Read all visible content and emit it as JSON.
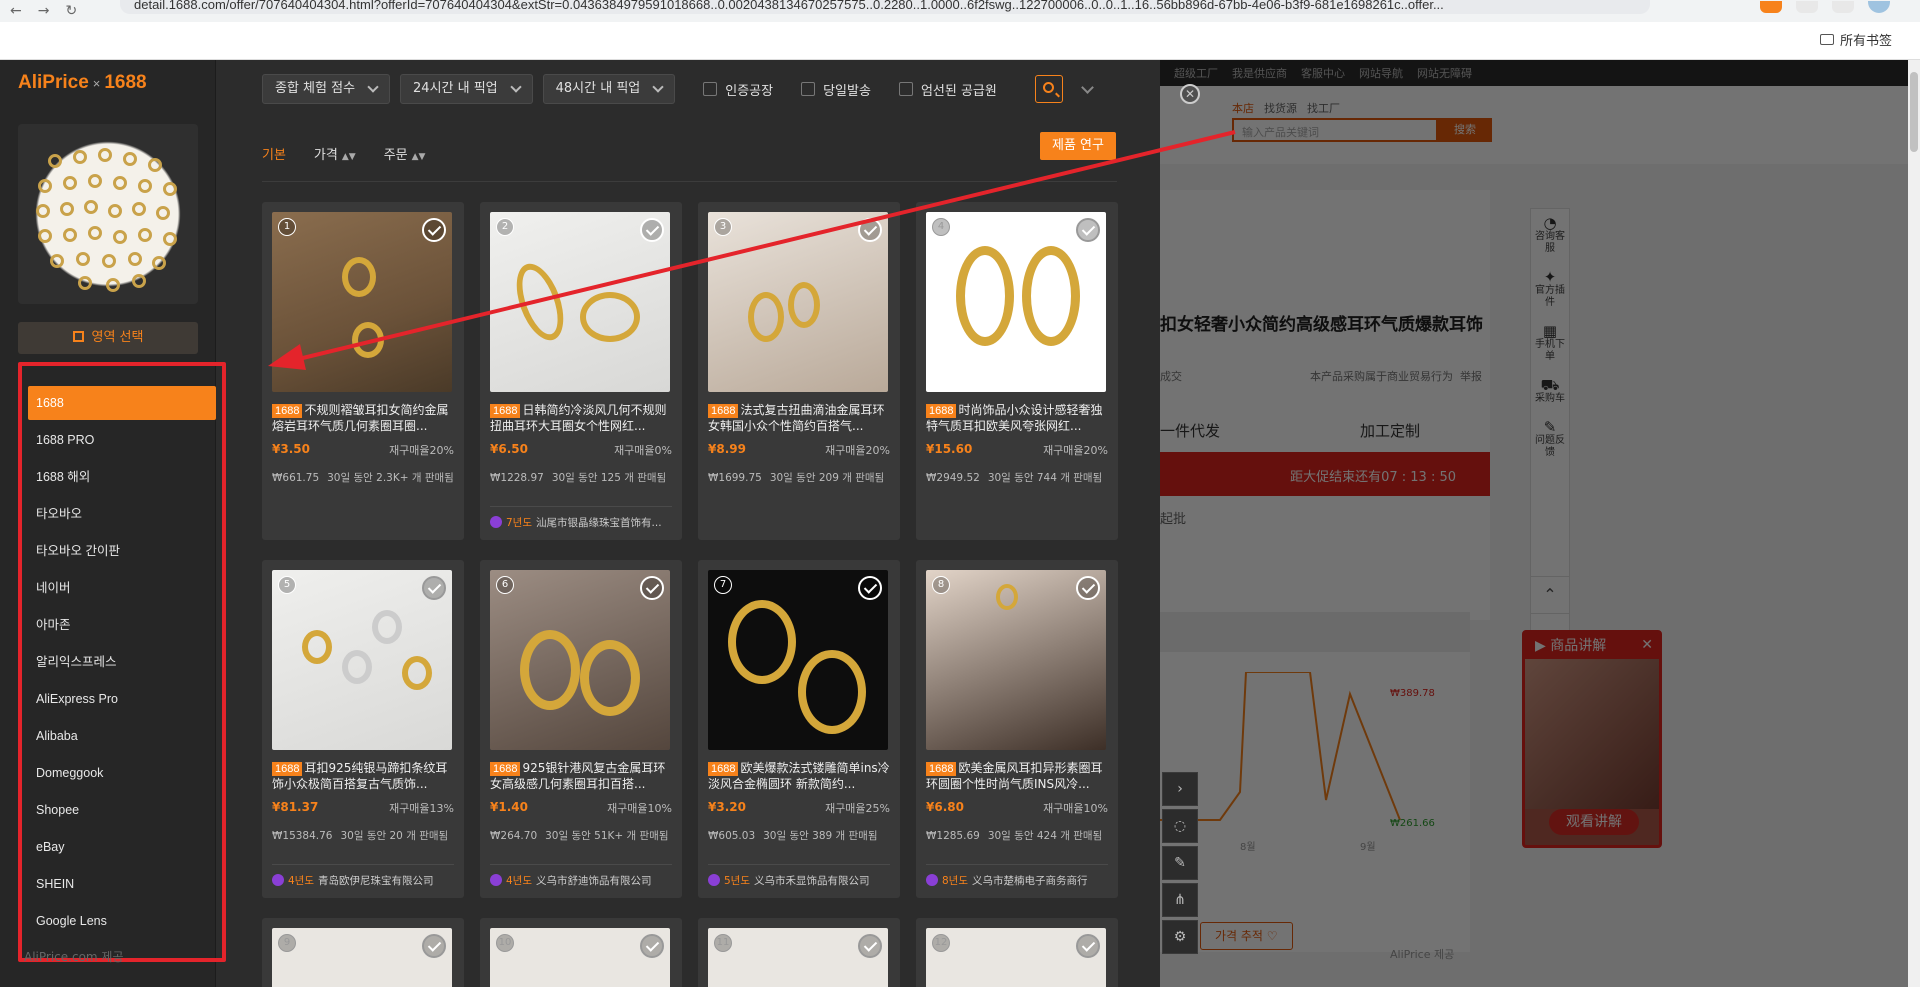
{
  "browser": {
    "url": "detail.1688.com/offer/707640404304.html?offerId=707640404304&extStr=0.0436384979591018668..0.0020438134670257575..0.2280..1.0000..6f2fswg..122700006..0..0..1..16..56bb896d-67bb-4e06-b3f9-681e1698261c..offer...",
    "bookmarks_label": "所有书签"
  },
  "panel": {
    "brand_left": "AliPrice",
    "brand_sep": "×",
    "brand_right": "1688",
    "area_select_label": "영역 선택",
    "sources": [
      {
        "label": "1688",
        "active": true
      },
      {
        "label": "1688 PRO"
      },
      {
        "label": "1688 해외"
      },
      {
        "label": "타오바오"
      },
      {
        "label": "타오바오 간이판"
      },
      {
        "label": "네이버"
      },
      {
        "label": "아마존"
      },
      {
        "label": "알리익스프레스"
      },
      {
        "label": "AliExpress Pro"
      },
      {
        "label": "Alibaba"
      },
      {
        "label": "Domeggook"
      },
      {
        "label": "Shopee"
      },
      {
        "label": "eBay"
      },
      {
        "label": "SHEIN"
      },
      {
        "label": "Google Lens"
      }
    ],
    "powered_by": "AliPrice.com 제공"
  },
  "filters": {
    "score": "종합 체험 점수",
    "pickup24": "24시간 내 픽업",
    "pickup48": "48시간 내 픽업",
    "certified": "인증공장",
    "sameday": "당일발송",
    "selected": "엄선된 공급원"
  },
  "sort": {
    "basic": "기본",
    "price": "가격",
    "orders": "주문",
    "research": "제품 연구"
  },
  "products": [
    {
      "n": "1",
      "badge": "1688",
      "title": "不规则褶皱耳扣女简约金属熔岩耳环气质几何素圈耳圈...",
      "price": "¥3.50",
      "rep": "재구매율20%",
      "krw": "₩661.75",
      "sold": "30일 동안 2.3K+ 개 판매됨",
      "seller": ""
    },
    {
      "n": "2",
      "badge": "1688",
      "title": "日韩简约冷淡风几何不规则扭曲耳环大耳圈女个性网红...",
      "price": "¥6.50",
      "rep": "재구매율0%",
      "krw": "₩1228.97",
      "sold": "30일 동안 125 개 판매됨",
      "years": "7년도",
      "seller": "汕尾市银晶缘珠宝首饰有..."
    },
    {
      "n": "3",
      "badge": "1688",
      "title": "法式复古扭曲滴油金属耳环女韩国小众个性简约百搭气...",
      "price": "¥8.99",
      "rep": "재구매율20%",
      "krw": "₩1699.75",
      "sold": "30일 동안 209 개 판매됨",
      "seller": ""
    },
    {
      "n": "4",
      "badge": "1688",
      "title": "时尚饰品小众设计感轻奢独特气质耳扣欧美风夸张网红...",
      "price": "¥15.60",
      "rep": "재구매율20%",
      "krw": "₩2949.52",
      "sold": "30일 동안 744 개 판매됨",
      "seller": ""
    },
    {
      "n": "5",
      "badge": "1688",
      "title": "耳扣925纯银马蹄扣条纹耳饰小众极简百搭复古气质饰...",
      "price": "¥81.37",
      "rep": "재구매율13%",
      "krw": "₩15384.76",
      "sold": "30일 동안 20 개 판매됨",
      "years": "4년도",
      "seller": "青岛欧伊尼珠宝有限公司"
    },
    {
      "n": "6",
      "badge": "1688",
      "title": "925银针港风复古金属耳环女高级感几何素圈耳扣百搭...",
      "price": "¥1.40",
      "rep": "재구매율10%",
      "krw": "₩264.70",
      "sold": "30일 동안 51K+ 개 판매됨",
      "years": "4년도",
      "seller": "义乌市舒迪饰品有限公司"
    },
    {
      "n": "7",
      "badge": "1688",
      "title": "欧美爆款法式镂雕简单ins冷淡风合金椭圆环 新款简约...",
      "price": "¥3.20",
      "rep": "재구매율25%",
      "krw": "₩605.03",
      "sold": "30일 동안 389 개 판매됨",
      "years": "5년도",
      "seller": "义乌市禾显饰品有限公司"
    },
    {
      "n": "8",
      "badge": "1688",
      "title": "欧美金属风耳扣异形素圈耳环圆圈个性时尚气质INS风冷...",
      "price": "¥6.80",
      "rep": "재구매율10%",
      "krw": "₩1285.69",
      "sold": "30일 동안 424 개 판매됨",
      "years": "8년도",
      "seller": "义乌市楚楠电子商务商行"
    },
    {
      "n": "9"
    },
    {
      "n": "10"
    },
    {
      "n": "11"
    },
    {
      "n": "12"
    }
  ],
  "webpage": {
    "topbar": [
      "超级工厂",
      "我是供应商",
      "客服中心",
      "网站导航",
      "网站无障碍"
    ],
    "tabs": [
      "本店",
      "找货源",
      "找工厂"
    ],
    "search_placeholder": "输入产品关键词",
    "search_btn": "搜索",
    "title": "扣女轻奢小众简约高级感耳环气质爆款耳饰",
    "note_small": "本产品采购属于商业贸易行为",
    "report": "举报",
    "trade": "成交",
    "opt1": "一件代发",
    "opt2": "加工定制",
    "promo": "距大促结束还有07 : 13 : 50",
    "start": "起批",
    "chart_high": "₩389.78",
    "chart_low": "₩261.66",
    "chart_x1": "8월",
    "chart_x2": "9월",
    "price_track": "가격 추적",
    "provided": "AliPrice 제공",
    "rail": [
      {
        "t": "咨询客服"
      },
      {
        "t": "官方插件"
      },
      {
        "t": "手机下单"
      },
      {
        "t": "采购车"
      },
      {
        "t": "问题反馈"
      }
    ],
    "video_title": "商品讲解",
    "video_btn": "观看讲解"
  }
}
